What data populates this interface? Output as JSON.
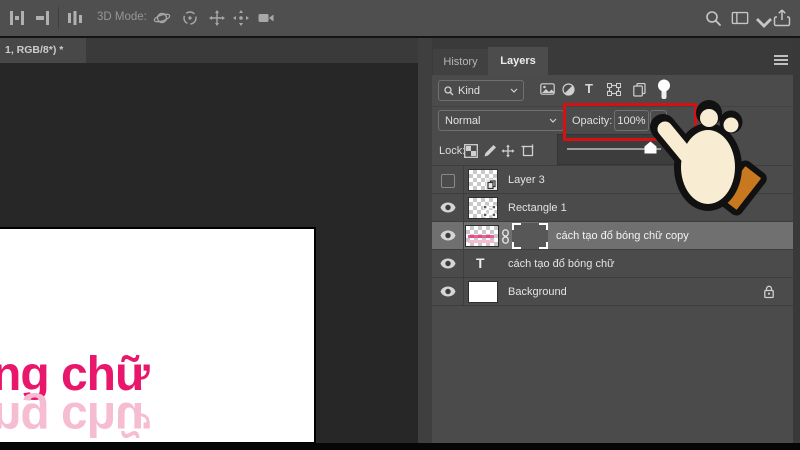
{
  "options_bar": {
    "mode_label": "3D Mode:",
    "left_icons": [
      "align-objects-icon",
      "align-edges-icon",
      "distribute-icon"
    ],
    "mode_icons": [
      "orbit-3d-icon",
      "roll-3d-icon",
      "drag-3d-icon",
      "slide-3d-icon",
      "camera-3d-icon"
    ],
    "right_icons": [
      "search-icon",
      "workspace-switcher-icon",
      "chevron-down-icon",
      "share-icon"
    ]
  },
  "document_tab": {
    "title": "1, RGB/8*) *"
  },
  "canvas": {
    "text": "ng chữ",
    "reflection_text": "ng chữ"
  },
  "panel": {
    "tabs": [
      {
        "label": "History"
      },
      {
        "label": "Layers"
      }
    ],
    "filter": {
      "label": "Kind",
      "icons": [
        "pixel-layer-filter-icon",
        "adjustment-layer-filter-icon",
        "type-layer-filter-icon",
        "shape-layer-filter-icon",
        "smart-object-filter-icon",
        "filter-toggle-icon"
      ]
    },
    "blend": {
      "mode": "Normal",
      "opacity_label": "Opacity:",
      "opacity_value": "100%"
    },
    "lock": {
      "label": "Lock:",
      "icons": [
        "lock-transparency-icon",
        "lock-pixels-icon",
        "lock-position-icon",
        "lock-artboard-icon"
      ]
    },
    "opacity_slider": {
      "value": 100
    },
    "layers": [
      {
        "name": "Layer 3",
        "visible": false,
        "type": "smart-object"
      },
      {
        "name": "Rectangle 1",
        "visible": true,
        "type": "shape"
      },
      {
        "name": "cách tạo đổ bóng chữ copy",
        "visible": true,
        "type": "pixel-with-mask",
        "selected": true
      },
      {
        "name": "cách tạo đổ bóng chữ",
        "visible": true,
        "type": "text"
      },
      {
        "name": "Background",
        "visible": true,
        "type": "background",
        "locked": true
      }
    ]
  },
  "colors": {
    "pink": "#e9176b",
    "pink_soft": "#f6bdd2",
    "red": "#d21311",
    "orange": "#c8791f"
  }
}
